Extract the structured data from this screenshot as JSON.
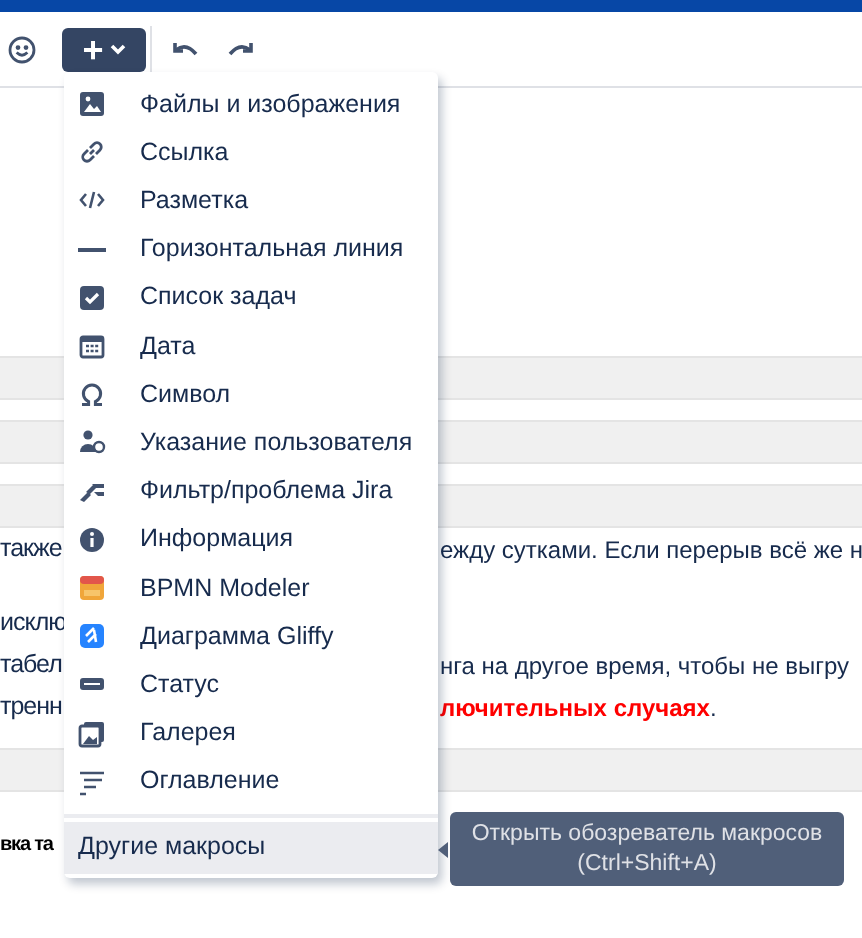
{
  "toolbar": {
    "insert_button": {
      "label": "+",
      "expanded": true
    }
  },
  "document": {
    "lines": [
      {
        "kind": "band"
      },
      {
        "kind": "band"
      },
      {
        "kind": "band"
      },
      {
        "kind": "text",
        "left": "также",
        "right": "ежду сутками. Если перерыв всё же н"
      },
      {
        "kind": "gap"
      },
      {
        "kind": "text",
        "left": "исклю"
      },
      {
        "kind": "text",
        "left": "табел",
        "right": "нга на другое время, чтобы не выгру"
      },
      {
        "kind": "text",
        "left": "тренн",
        "right": "**лючительных случаях**."
      },
      {
        "kind": "band"
      },
      {
        "kind": "heading",
        "left": "вка та"
      }
    ]
  },
  "insert_menu": {
    "items": [
      {
        "label": "Файлы и изображения",
        "selected": false
      },
      {
        "label": "Ссылка",
        "selected": false
      },
      {
        "label": "Разметка",
        "selected": false
      },
      {
        "label": "Горизонтальная линия",
        "selected": false
      },
      {
        "label": "Список задач",
        "selected": false
      },
      {
        "label": "Дата",
        "selected": false
      },
      {
        "label": "Символ",
        "selected": false
      },
      {
        "label": "Указание пользователя",
        "selected": false
      },
      {
        "label": "Фильтр/проблема Jira",
        "selected": false
      },
      {
        "label": "Информация",
        "selected": false
      },
      {
        "label": "BPMN Modeler",
        "selected": false
      },
      {
        "label": "Диаграмма Gliffy",
        "selected": false
      },
      {
        "label": "Статус",
        "selected": false
      },
      {
        "label": "Галерея",
        "selected": false
      },
      {
        "label": "Оглавление",
        "selected": false
      }
    ],
    "more": {
      "label": "Другие макросы",
      "selected": true
    }
  },
  "tooltip": {
    "lines": [
      "Открыть обозреватель макросов",
      "(Ctrl+Shift+A)"
    ]
  }
}
